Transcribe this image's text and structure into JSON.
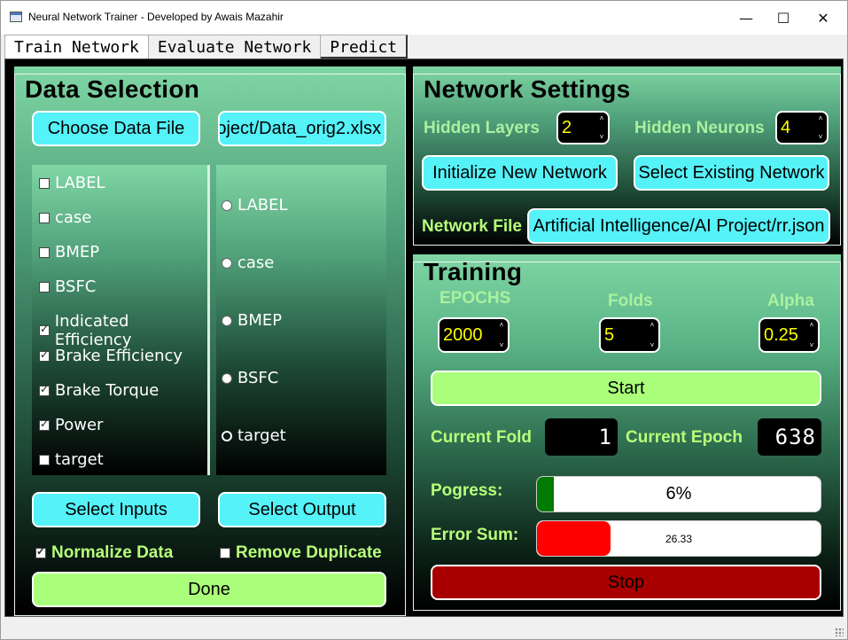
{
  "window": {
    "title": "Neural Network Trainer - Developed by Awais Mazahir",
    "minimize_icon": "—",
    "maximize_icon": "☐",
    "close_icon": "✕"
  },
  "tabs": [
    {
      "label": "Train Network",
      "active": true
    },
    {
      "label": "Evaluate Network",
      "active": false
    },
    {
      "label": "Predict",
      "active": false
    }
  ],
  "data_selection": {
    "title": "Data  Selection",
    "choose_file_label": "Choose Data File",
    "file_path": "oject/Data_orig2.xlsx",
    "inputs": [
      {
        "label": "LABEL",
        "checked": false
      },
      {
        "label": "case",
        "checked": false
      },
      {
        "label": "BMEP",
        "checked": false
      },
      {
        "label": "BSFC",
        "checked": false
      },
      {
        "label": "Indicated Efficiency",
        "checked": true
      },
      {
        "label": "Brake Efficiency",
        "checked": true
      },
      {
        "label": "Brake Torque",
        "checked": true
      },
      {
        "label": "Power",
        "checked": true
      },
      {
        "label": "target",
        "checked": false
      }
    ],
    "outputs": [
      {
        "label": "LABEL",
        "selected": false
      },
      {
        "label": "case",
        "selected": false
      },
      {
        "label": "BMEP",
        "selected": false
      },
      {
        "label": "BSFC",
        "selected": false
      },
      {
        "label": "target",
        "selected": true
      }
    ],
    "select_inputs_label": "Select Inputs",
    "select_output_label": "Select Output",
    "normalize_label": "Normalize Data",
    "normalize_checked": true,
    "remove_duplicate_label": "Remove Duplicate",
    "remove_duplicate_checked": false,
    "done_label": "Done"
  },
  "network_settings": {
    "title": "Network Settings",
    "hidden_layers_label": "Hidden Layers",
    "hidden_layers_value": "2",
    "hidden_neurons_label": "Hidden Neurons",
    "hidden_neurons_value": "4",
    "init_network_label": "Initialize New Network",
    "select_network_label": "Select Existing Network",
    "network_file_label": "Network File",
    "network_file_path": "Artificial Intelligence/AI Project/rr.json"
  },
  "training": {
    "title": "Training",
    "epochs_label": "EPOCHS",
    "epochs_value": "2000",
    "folds_label": "Folds",
    "folds_value": "5",
    "alpha_label": "Alpha",
    "alpha_value": "0.25",
    "start_label": "Start",
    "current_fold_label": "Current Fold",
    "current_fold_value": "1",
    "current_epoch_label": "Current Epoch",
    "current_epoch_value": "638",
    "progress_label": "Pogress:",
    "progress_text": "6%",
    "progress_fraction": 0.06,
    "progress_color": "#007a00",
    "error_label": "Error Sum:",
    "error_text": "26.33",
    "error_fraction": 0.26,
    "error_color": "#ff0000",
    "stop_label": "Stop"
  }
}
